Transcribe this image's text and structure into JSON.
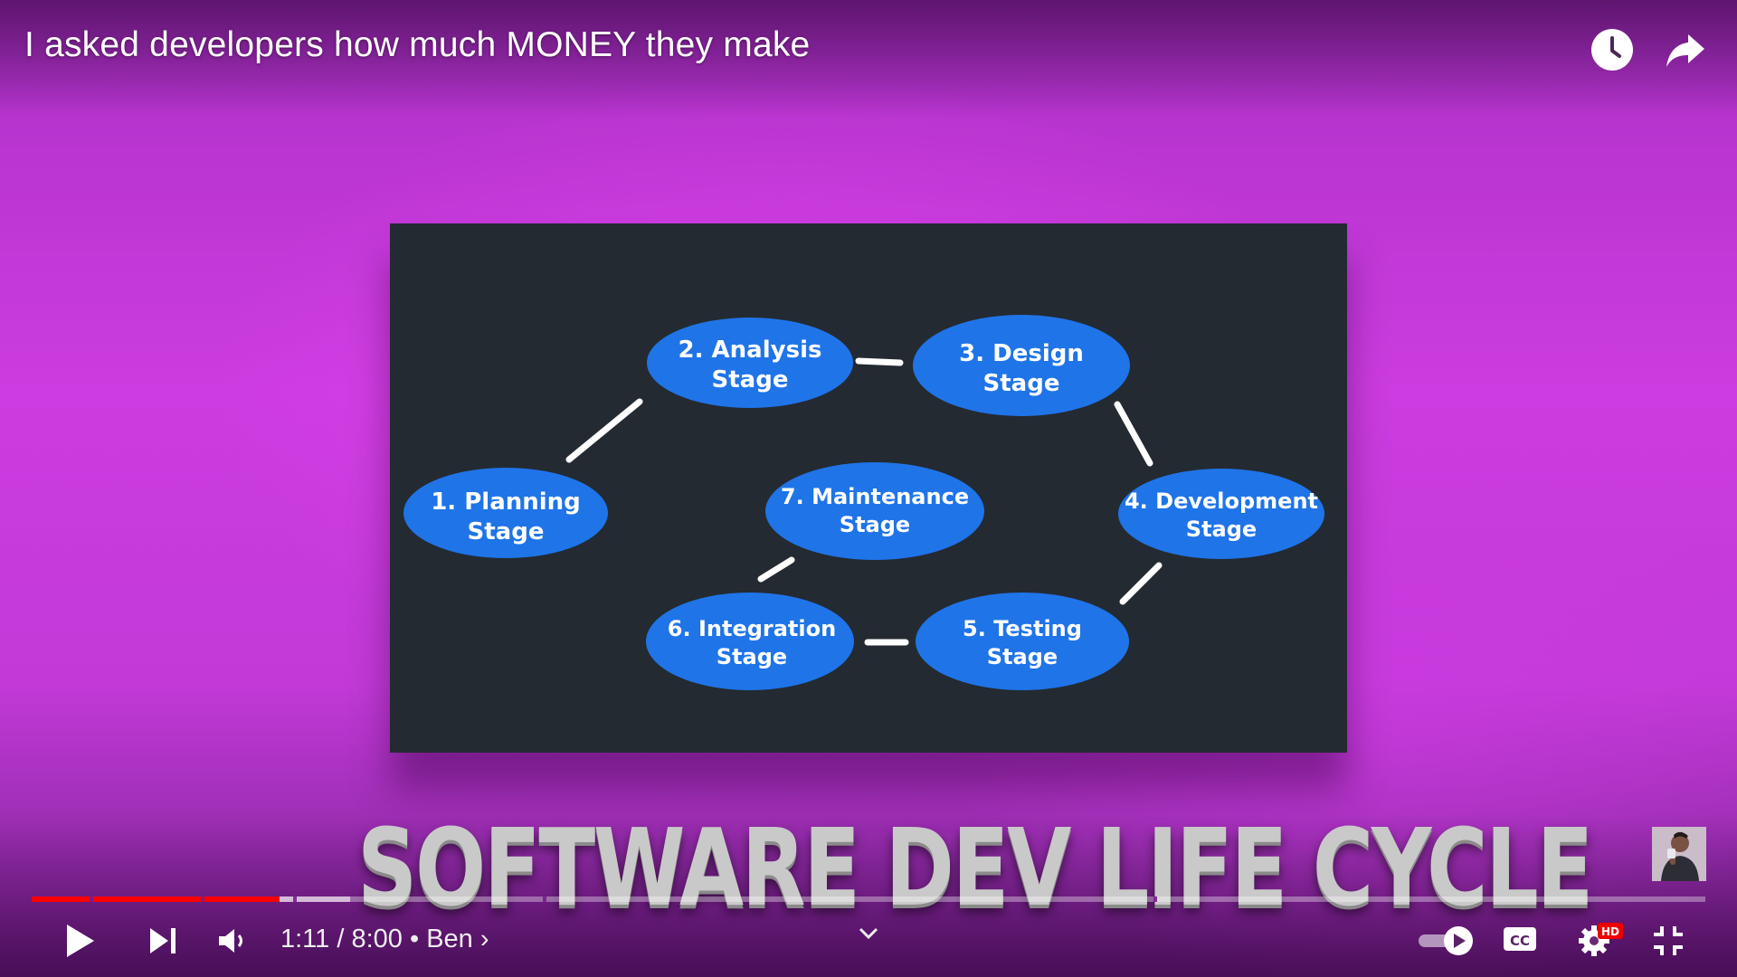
{
  "video": {
    "title": "I asked developers how much MONEY they make",
    "caption": "SOFTWARE DEV LIFE CYCLE"
  },
  "top_actions": [
    {
      "name": "watch-later-icon"
    },
    {
      "name": "share-icon"
    }
  ],
  "slide": {
    "background": "#232a31",
    "node_color": "#1f74e8",
    "nodes": [
      {
        "id": "planning",
        "line1": "1. Planning",
        "line2": "Stage"
      },
      {
        "id": "analysis",
        "line1": "2. Analysis",
        "line2": "Stage"
      },
      {
        "id": "design",
        "line1": "3. Design",
        "line2": "Stage"
      },
      {
        "id": "development",
        "line1": "4. Development",
        "line2": "Stage"
      },
      {
        "id": "testing",
        "line1": "5. Testing",
        "line2": "Stage"
      },
      {
        "id": "integration",
        "line1": "6. Integration",
        "line2": "Stage"
      },
      {
        "id": "maintenance",
        "line1": "7. Maintenance",
        "line2": "Stage"
      }
    ]
  },
  "player": {
    "current_time": "1:11",
    "duration": "8:00",
    "time_display": "1:11 / 8:00",
    "separator": "•",
    "chapter": "Ben",
    "chapter_arrow": "›",
    "progress_fraction": 0.148,
    "buffered_fraction": 0.19,
    "hd_badge": "HD",
    "cc_label": "CC",
    "autoplay": true,
    "accent": "#ff0000"
  }
}
